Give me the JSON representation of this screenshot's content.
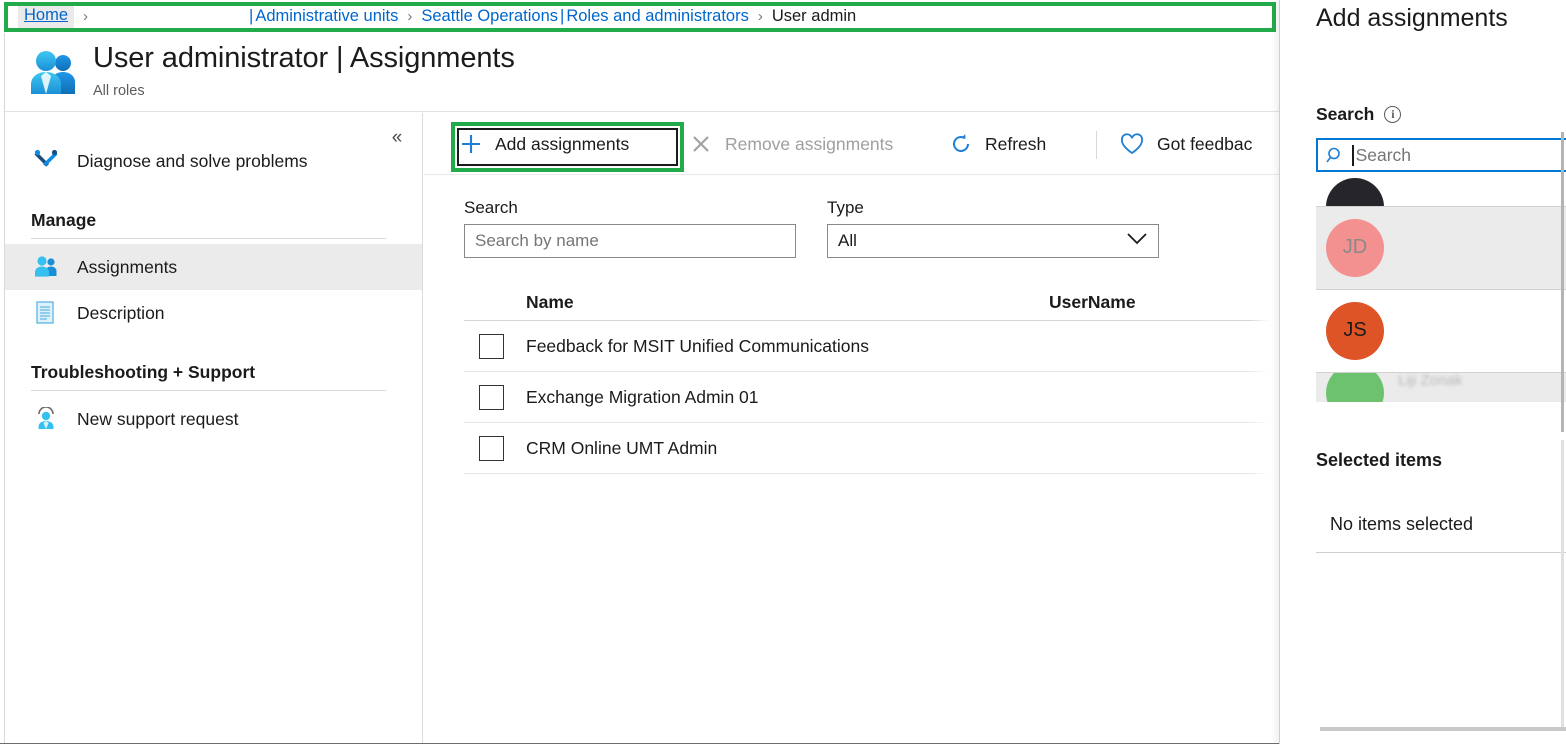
{
  "breadcrumb": {
    "home": "Home",
    "separator": "›",
    "redacted": "",
    "pipe": "|",
    "admin_units": "Administrative units",
    "seattle": "Seattle Operations",
    "roles": "Roles and administrators",
    "current": "User admin"
  },
  "header": {
    "title": "User administrator | Assignments",
    "subtitle": "All roles",
    "icon": "users-icon"
  },
  "sidebar": {
    "collapse_icon": "«",
    "items": [
      {
        "label": "Diagnose and solve problems",
        "icon": "wrench-screwdriver-icon",
        "selected": false
      },
      {
        "label": "Assignments",
        "icon": "users-icon",
        "selected": true
      },
      {
        "label": "Description",
        "icon": "document-icon",
        "selected": false
      },
      {
        "label": "New support request",
        "icon": "support-person-icon",
        "selected": false
      }
    ],
    "sections": [
      {
        "label": "Manage"
      },
      {
        "label": "Troubleshooting + Support"
      }
    ]
  },
  "toolbar": {
    "add_assignments": "Add assignments",
    "add_icon": "plus-icon",
    "remove_assignments": "Remove assignments",
    "remove_icon": "x-icon",
    "refresh": "Refresh",
    "refresh_icon": "refresh-icon",
    "got_feedback": "Got feedbac",
    "feedback_icon": "heart-icon"
  },
  "filters": {
    "search_label": "Search",
    "search_placeholder": "Search by name",
    "search_value": "",
    "type_label": "Type",
    "type_value": "All",
    "type_chevron": "chevron-down-icon"
  },
  "table": {
    "columns": [
      "Name",
      "UserName"
    ],
    "rows": [
      {
        "name": "Feedback for MSIT Unified Communications",
        "username": ""
      },
      {
        "name": "Exchange Migration Admin 01",
        "username": ""
      },
      {
        "name": "CRM Online UMT Admin",
        "username": ""
      }
    ]
  },
  "panel": {
    "title": "Add assignments",
    "search_label": "Search",
    "info_icon": "info-icon",
    "search_icon": "search-icon",
    "search_placeholder": "Search",
    "search_value": "",
    "results": [
      {
        "initials": "",
        "color": "#26262a",
        "text_color": "#ffffff",
        "alt": false,
        "clipped": "top"
      },
      {
        "initials": "JD",
        "color": "#f2918f",
        "text_color": "#8a8a8a",
        "alt": true,
        "clipped": "none"
      },
      {
        "initials": "JS",
        "color": "#df5427",
        "text_color": "#1b1b1b",
        "alt": false,
        "clipped": "none"
      },
      {
        "initials": "",
        "color": "#6dc36d",
        "text_color": "#ffffff",
        "alt": true,
        "clipped": "bottom"
      }
    ],
    "selected_title": "Selected items",
    "selected_empty": "No items selected"
  },
  "colors": {
    "highlight_green": "#22ab4b",
    "link_blue": "#0066cc",
    "focus_blue": "#0078d4",
    "accent_blue": "#0078d4",
    "selected_row_bg": "#ebebeb"
  }
}
